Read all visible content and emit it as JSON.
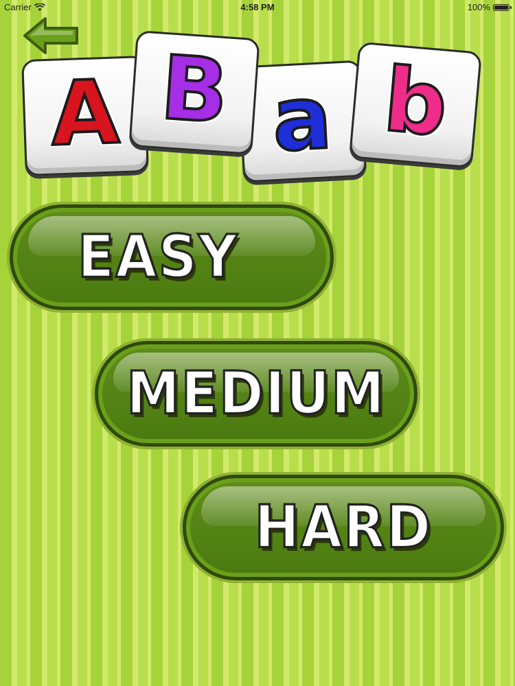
{
  "status_bar": {
    "carrier": "Carrier",
    "time": "4:58 PM",
    "battery": "100%"
  },
  "back_button": {
    "icon": "back-arrow-icon",
    "color": "#6aa01a"
  },
  "tiles": [
    {
      "letter": "A",
      "color": "#d8141e"
    },
    {
      "letter": "B",
      "color": "#a52ee6"
    },
    {
      "letter": "a",
      "color": "#1e2ed8"
    },
    {
      "letter": "b",
      "color": "#ee2d8a"
    }
  ],
  "difficulty": {
    "easy": "EASY",
    "medium": "MEDIUM",
    "hard": "HARD"
  }
}
